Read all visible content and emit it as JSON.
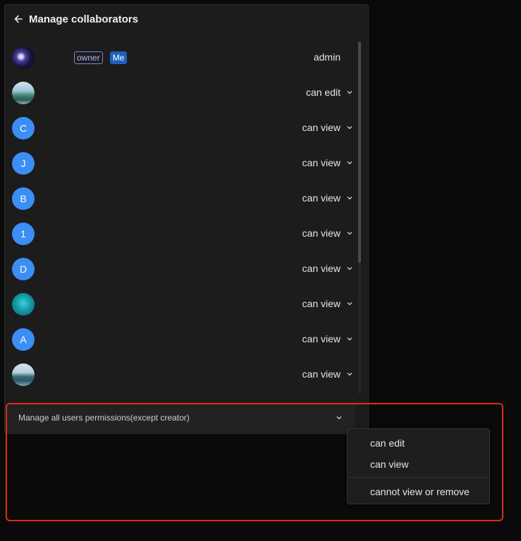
{
  "header": {
    "title": "Manage collaborators",
    "back_icon": "arrow-left-icon"
  },
  "collaborators": [
    {
      "avatar": "",
      "avatar_type": "photo-galaxy",
      "badges": {
        "owner": "owner",
        "me": "Me"
      },
      "permission": "admin"
    },
    {
      "avatar": "",
      "avatar_type": "photo-mountain",
      "permission": "can edit"
    },
    {
      "avatar": "C",
      "avatar_type": "letter",
      "permission": "can view"
    },
    {
      "avatar": "J",
      "avatar_type": "letter",
      "permission": "can view"
    },
    {
      "avatar": "B",
      "avatar_type": "letter",
      "permission": "can view"
    },
    {
      "avatar": "1",
      "avatar_type": "letter",
      "permission": "can view"
    },
    {
      "avatar": "D",
      "avatar_type": "letter",
      "permission": "can view"
    },
    {
      "avatar": "",
      "avatar_type": "photo-sea",
      "permission": "can view"
    },
    {
      "avatar": "A",
      "avatar_type": "letter",
      "permission": "can view"
    },
    {
      "avatar": "",
      "avatar_type": "photo-cliff",
      "permission": "can view"
    }
  ],
  "bulk": {
    "label": "Manage all users permissions(except creator)"
  },
  "menu": {
    "items": [
      "can edit",
      "can view",
      "cannot view or remove"
    ]
  },
  "colors": {
    "accent": "#3b8ef3",
    "highlight": "#e02a1c",
    "me_badge": "#1f5fbf"
  }
}
